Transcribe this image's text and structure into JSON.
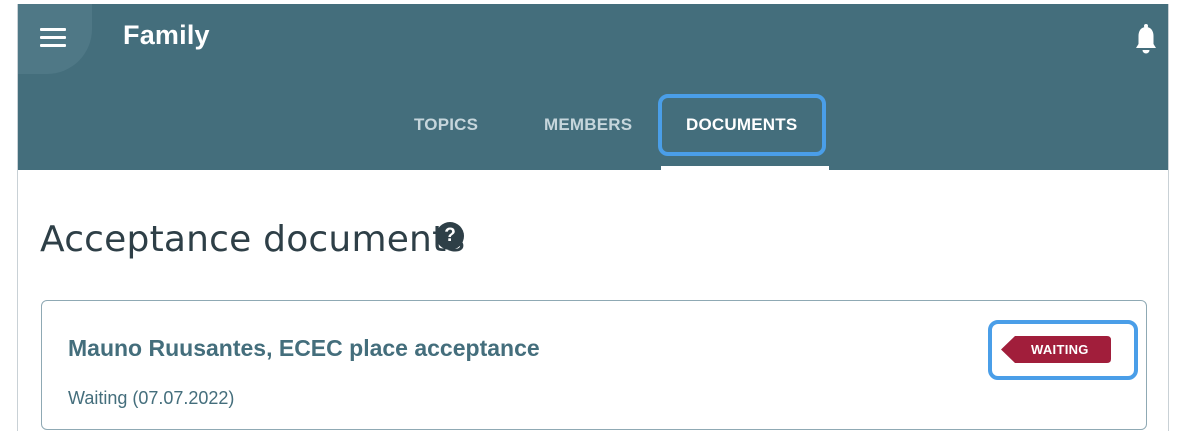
{
  "app": {
    "title": "Family"
  },
  "icons": {
    "menu": "hamburger-menu-icon",
    "notifications": "bell-icon",
    "help": "help-icon"
  },
  "tabs": [
    {
      "label": "TOPICS"
    },
    {
      "label": "MEMBERS"
    },
    {
      "label": "DOCUMENTS",
      "active": true
    }
  ],
  "section": {
    "title": "Acceptance documents",
    "help_glyph": "?"
  },
  "documents": [
    {
      "title": "Mauno Ruusantes, ECEC place acceptance",
      "status_text": "Waiting (07.07.2022)",
      "badge": "WAITING"
    }
  ],
  "colors": {
    "header": "#446e7c",
    "badge": "#a11e3b",
    "highlight": "#4a9ee8",
    "text": "#2e3f47"
  }
}
